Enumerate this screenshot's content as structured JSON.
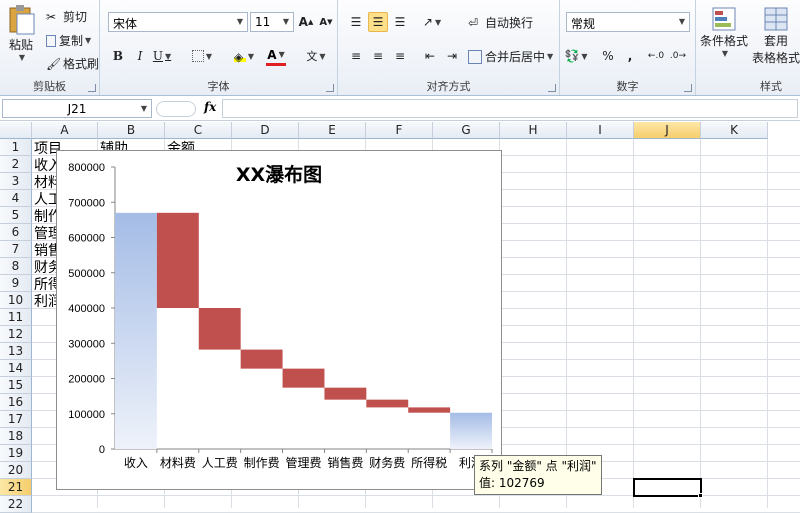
{
  "ribbon": {
    "clipboard": {
      "paste": "粘贴",
      "cut": "剪切",
      "copy": "复制",
      "format_painter": "格式刷",
      "group": "剪贴板"
    },
    "font": {
      "name": "宋体",
      "size": "11",
      "bold": "B",
      "italic": "I",
      "underline": "U",
      "group": "字体"
    },
    "alignment": {
      "wrap": "自动换行",
      "merge": "合并后居中",
      "group": "对齐方式"
    },
    "number": {
      "format": "常规",
      "percent": "%",
      "comma": ",",
      "group": "数字"
    },
    "styles": {
      "conditional": "条件格式",
      "table_l1": "套用",
      "table_l2": "表格格式",
      "group": "样式"
    }
  },
  "formula_bar": {
    "name_box": "J21",
    "fx": "fx",
    "value": ""
  },
  "sheet": {
    "columns": [
      "A",
      "B",
      "C",
      "D",
      "E",
      "F",
      "G",
      "H",
      "I",
      "J",
      "K"
    ],
    "selected_column": "J",
    "rows": [
      "1",
      "2",
      "3",
      "4",
      "5",
      "6",
      "7",
      "8",
      "9",
      "10",
      "11",
      "12",
      "13",
      "14",
      "15",
      "16",
      "17",
      "18",
      "19",
      "20",
      "21",
      "22"
    ],
    "selected_row": "21",
    "cells": {
      "A1": "项目",
      "B1": "辅助",
      "C1": "金额",
      "A2": "收入",
      "A3": "材料",
      "A4": "人工",
      "A5": "制作",
      "A6": "管理",
      "A7": "销售",
      "A8": "财务",
      "A9": "所得",
      "A10": "利润"
    }
  },
  "chart_data": {
    "type": "bar",
    "title": "XX瀑布图",
    "categories": [
      "收入",
      "材料费",
      "人工费",
      "制作费",
      "管理费",
      "销售费",
      "财务费",
      "所得税",
      "利润"
    ],
    "series": [
      {
        "name": "辅助",
        "values": [
          0,
          400000,
          282000,
          228000,
          174000,
          140000,
          118000,
          103000,
          0
        ]
      },
      {
        "name": "金额",
        "values": [
          670000,
          270000,
          118000,
          54000,
          54000,
          34000,
          22000,
          15000,
          102769
        ]
      }
    ],
    "ylim": [
      0,
      800000
    ],
    "yticks": [
      "800000",
      "700000",
      "600000",
      "500000",
      "400000",
      "300000",
      "200000",
      "100000",
      "0"
    ],
    "colors": {
      "total": "#a4bce6",
      "delta": "#c0504d"
    }
  },
  "tooltip": {
    "line1": "系列 \"金额\" 点 \"利润\"",
    "line2": "值: 102769"
  }
}
